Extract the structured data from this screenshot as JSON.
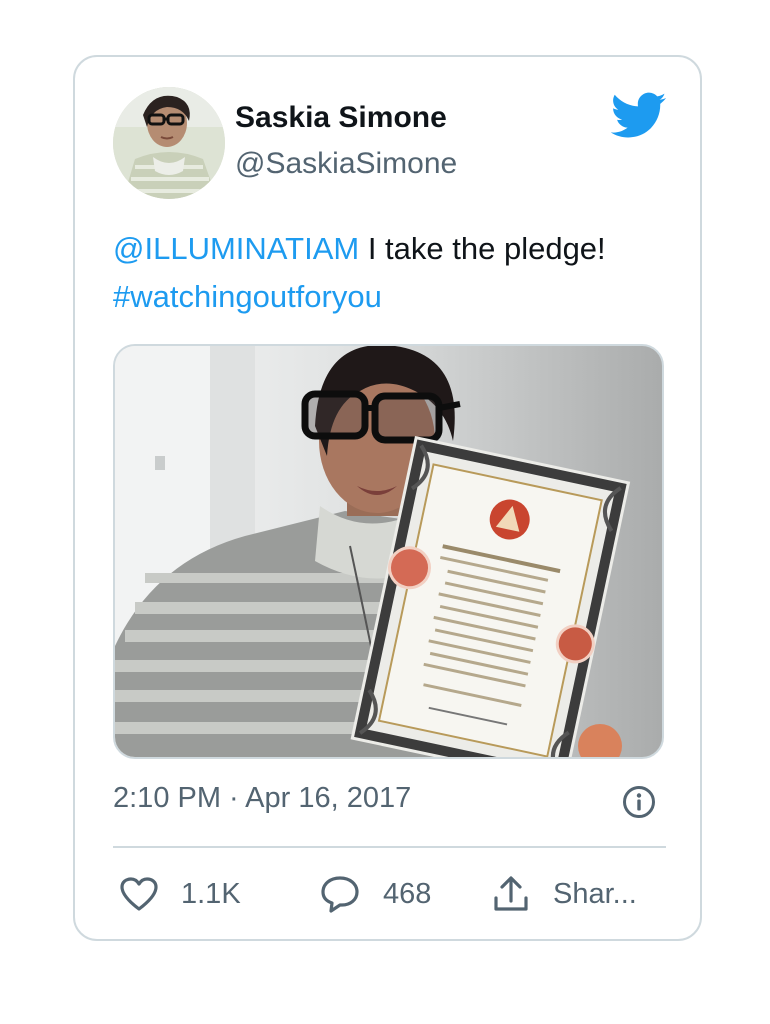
{
  "author": {
    "display_name": "Saskia Simone",
    "handle": "@SaskiaSimone"
  },
  "tweet": {
    "mention": "@ILLUMINATIAM",
    "text": " I take the pledge!",
    "hashtag": "#watchingoutforyou",
    "timestamp": "2:10 PM · Apr 16, 2017"
  },
  "actions": {
    "like_count": "1.1K",
    "reply_count": "468",
    "share_label": "Shar..."
  },
  "icons": {
    "brand": "twitter-bird-icon",
    "info": "info-icon",
    "like": "heart-icon",
    "reply": "speech-bubble-icon",
    "share": "share-upload-icon"
  },
  "colors": {
    "brand": "#1d9bf0",
    "text": "#0f1419",
    "secondary": "#536471",
    "border": "#cfd9de"
  }
}
